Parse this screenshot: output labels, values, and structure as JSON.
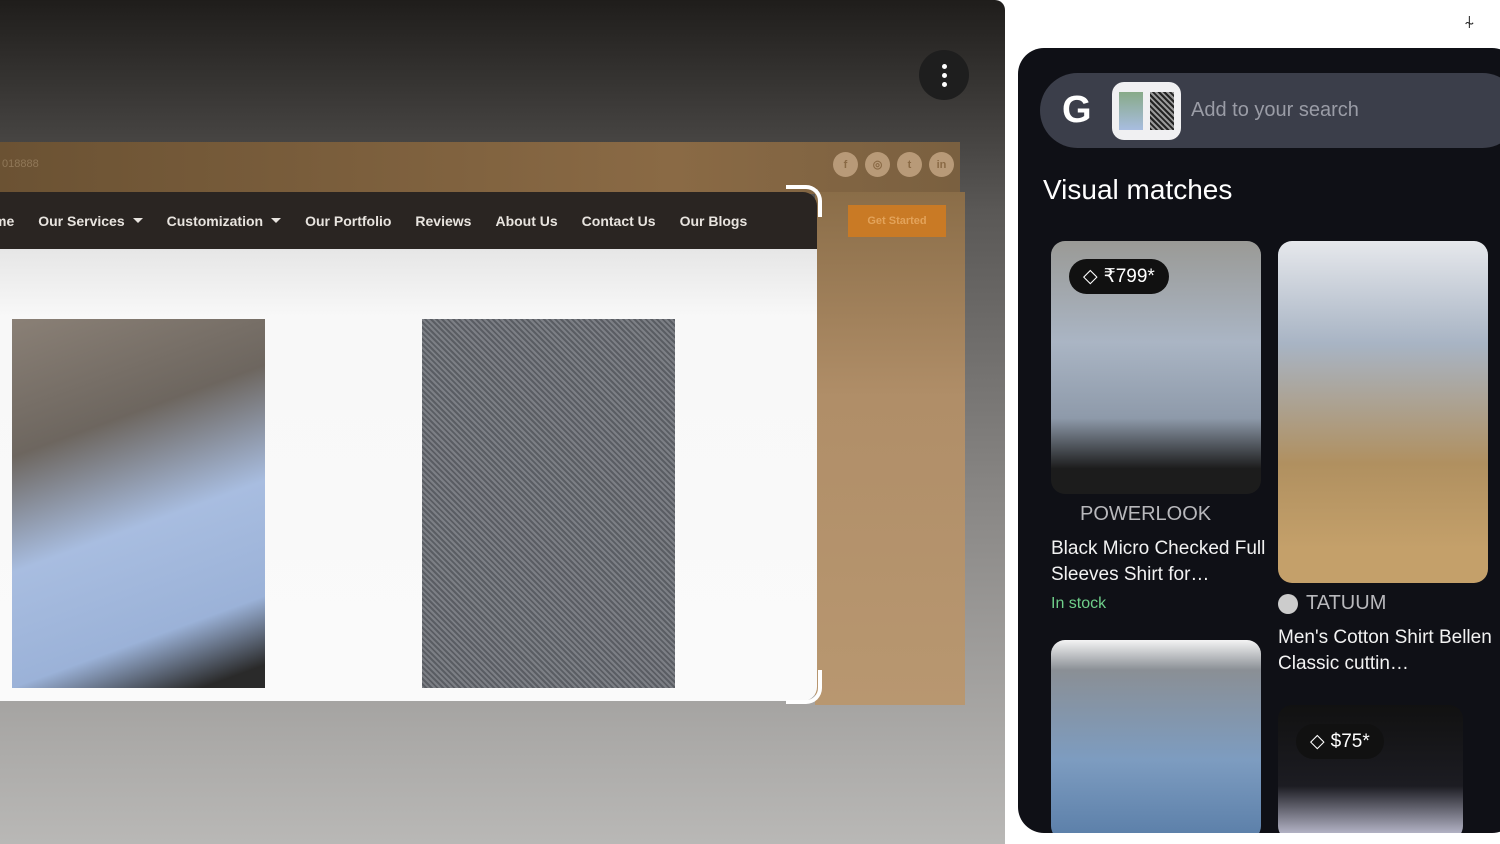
{
  "website": {
    "phone": "018888",
    "social": [
      "facebook",
      "instagram",
      "twitter",
      "linkedin"
    ],
    "nav": [
      {
        "label": "me"
      },
      {
        "label": "Our Services",
        "dropdown": true
      },
      {
        "label": "Customization",
        "dropdown": true
      },
      {
        "label": "Our Portfolio"
      },
      {
        "label": "Reviews"
      },
      {
        "label": "About Us"
      },
      {
        "label": "Contact Us"
      },
      {
        "label": "Our Blogs"
      }
    ],
    "cta": "Get Started"
  },
  "lens": {
    "search_placeholder": "Add to your search",
    "google_logo": "G",
    "heading": "Visual matches",
    "results": [
      {
        "price": "₹799*",
        "source": "POWERLOOK",
        "title": "Black Micro Checked Full Sleeves Shirt for…",
        "status": "In stock"
      },
      {
        "source": "TATUUM",
        "title": "Men's Cotton Shirt Bellen Classic cuttin…"
      },
      {},
      {
        "price": "$75*"
      }
    ]
  },
  "colors": {
    "accent": "#c97a25",
    "stock": "#6fcf8a",
    "panel": "#0f1016"
  }
}
